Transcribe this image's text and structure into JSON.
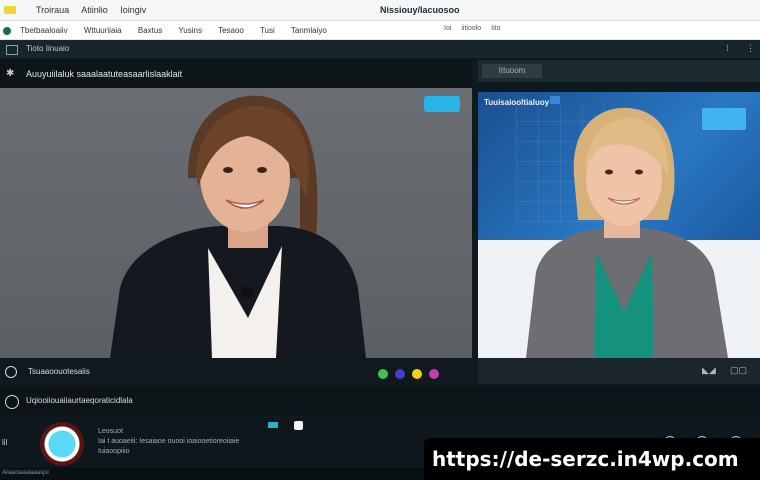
{
  "titlebar": {
    "tabs": [
      "Troiraua",
      "Atiinlio",
      "Ioingiv"
    ],
    "center_title": "Nissiouy/Iacuosoo"
  },
  "menubar": {
    "items": [
      "Tbetbaaloaiiv",
      "Wttuuriiaia",
      "Baxtus",
      "Yusins",
      "Tesaoo",
      "Tusi",
      "Tanmlaiyo"
    ],
    "right_items": [
      "Ioi",
      "iitioolo",
      "Iito"
    ]
  },
  "subbar": {
    "label": "Tioto   Iinuaio"
  },
  "main_tile": {
    "header_text": "Auuyuiilaluk saaalaatuteasaarlislaaklait"
  },
  "right_tile": {
    "header_box": "Ittuoom",
    "name_label": "Tuuisaiooltialuoy"
  },
  "bottom_left_bar": {
    "text": "Tsuaaoouotesaiis",
    "dot_colors": [
      "#3ec15a",
      "#4a3ad0",
      "#f2d21b",
      "#c23ea8"
    ]
  },
  "row2": {
    "text": "Uqiooiiouaiiaurtaeqoraticidlala"
  },
  "chatbar": {
    "left_text": "lil",
    "message_lines": [
      "Leosuot",
      "Iai t auoaeiii: Iesaiaoe ouooi ioaiooetioreoiiaie",
      "Iuiaoopiiio"
    ]
  },
  "statusbar": {
    "text": "Aiiaaoaaaiaaasjsi"
  },
  "banner": {
    "url": "https://de-serzc.in4wp.com"
  }
}
